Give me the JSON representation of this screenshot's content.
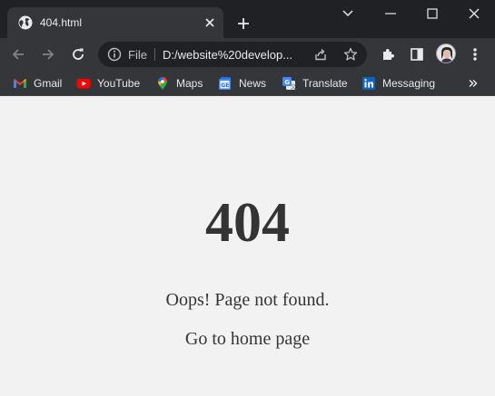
{
  "tab": {
    "title": "404.html"
  },
  "toolbar": {
    "scheme_label": "File",
    "url": "D:/website%20develop..."
  },
  "bookmarks": [
    {
      "label": "Gmail",
      "icon": "gmail-icon"
    },
    {
      "label": "YouTube",
      "icon": "youtube-icon"
    },
    {
      "label": "Maps",
      "icon": "maps-icon"
    },
    {
      "label": "News",
      "icon": "news-icon"
    },
    {
      "label": "Translate",
      "icon": "translate-icon"
    },
    {
      "label": "Messaging",
      "icon": "linkedin-icon"
    }
  ],
  "page": {
    "error_code": "404",
    "message": "Oops! Page not found.",
    "home_link": "Go to home page"
  },
  "colors": {
    "tabstrip": "#202124",
    "toolbar": "#35363a",
    "page_background": "#f2f2f2",
    "page_text": "#343434"
  }
}
